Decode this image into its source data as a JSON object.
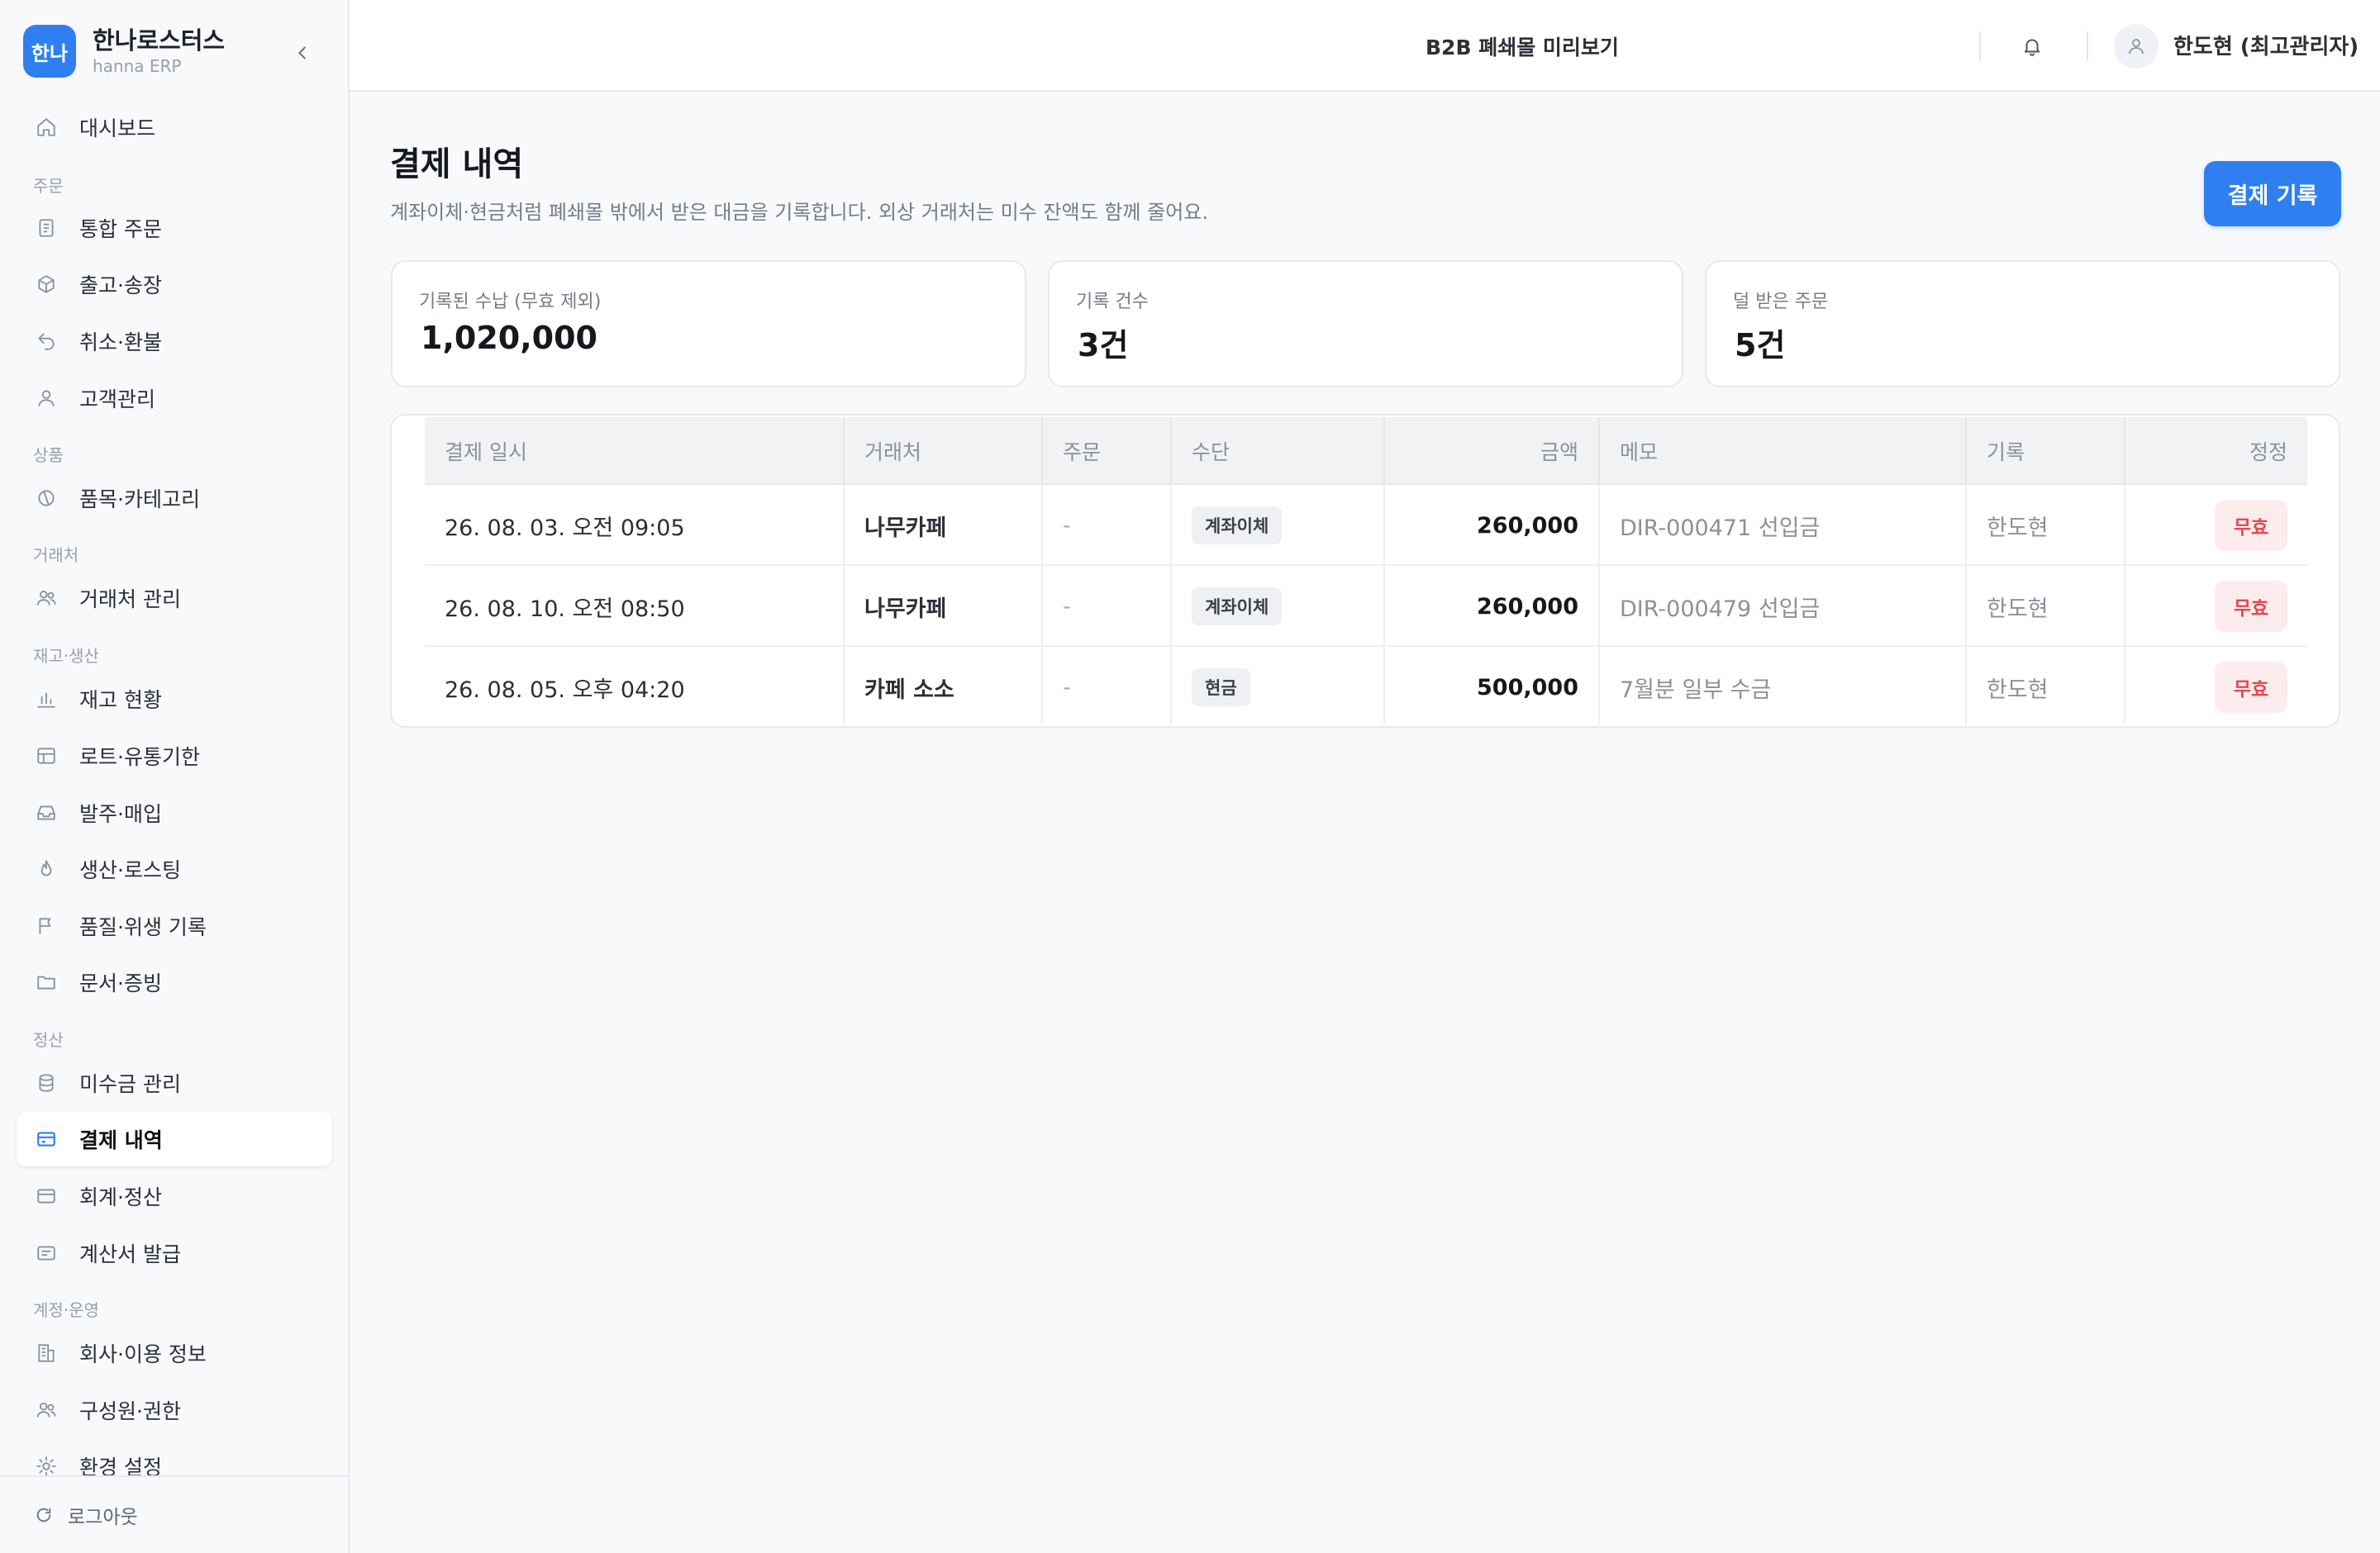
{
  "brand": {
    "logo_text": "한나",
    "name": "한나로스터스",
    "sub": "hanna ERP"
  },
  "sidebar": {
    "dashboard": "대시보드",
    "sections": {
      "order": "주문",
      "product": "상품",
      "partner": "거래처",
      "inventory": "재고·생산",
      "settlement": "정산",
      "account": "계정·운영"
    },
    "items": {
      "orders": "통합 주문",
      "shipping": "출고·송장",
      "refund": "취소·환불",
      "customers": "고객관리",
      "category": "품목·카테고리",
      "partners": "거래처 관리",
      "stock": "재고 현황",
      "lot": "로트·유통기한",
      "purchase": "발주·매입",
      "roasting": "생산·로스팅",
      "quality": "품질·위생 기록",
      "docs": "문서·증빙",
      "receivables": "미수금 관리",
      "payments": "결제 내역",
      "accounting": "회계·정산",
      "invoice": "계산서 발급",
      "company": "회사·이용 정보",
      "members": "구성원·권한",
      "settings": "환경 설정"
    },
    "logout": "로그아웃"
  },
  "topbar": {
    "preview": "B2B 폐쇄몰 미리보기",
    "user": "한도현 (최고관리자)"
  },
  "main": {
    "title": "결제 내역",
    "description": "계좌이체·현금처럼 폐쇄몰 밖에서 받은 대금을 기록합니다. 외상 거래처는 미수 잔액도 함께 줄어요.",
    "record_button": "결제 기록",
    "stats": [
      {
        "label": "기록된 수납 (무효 제외)",
        "value": "1,020,000"
      },
      {
        "label": "기록 건수",
        "value": "3건"
      },
      {
        "label": "덜 받은 주문",
        "value": "5건"
      }
    ],
    "table": {
      "headers": [
        "결제 일시",
        "거래처",
        "주문",
        "수단",
        "금액",
        "메모",
        "기록",
        "정정"
      ],
      "rows": [
        {
          "datetime": "26. 08. 03. 오전 09:05",
          "partner": "나무카페",
          "order": "-",
          "method": "계좌이체",
          "amount": "260,000",
          "memo": "DIR-000471 선입금",
          "recorder": "한도현",
          "action": "무효"
        },
        {
          "datetime": "26. 08. 10. 오전 08:50",
          "partner": "나무카페",
          "order": "-",
          "method": "계좌이체",
          "amount": "260,000",
          "memo": "DIR-000479 선입금",
          "recorder": "한도현",
          "action": "무효"
        },
        {
          "datetime": "26. 08. 05. 오후 04:20",
          "partner": "카페 소소",
          "order": "-",
          "method": "현금",
          "amount": "500,000",
          "memo": "7월분 일부 수금",
          "recorder": "한도현",
          "action": "무효"
        }
      ]
    }
  },
  "colors": {
    "accent": "#2f7ff0",
    "danger": "#e5484d",
    "danger_bg": "#fdecee"
  }
}
